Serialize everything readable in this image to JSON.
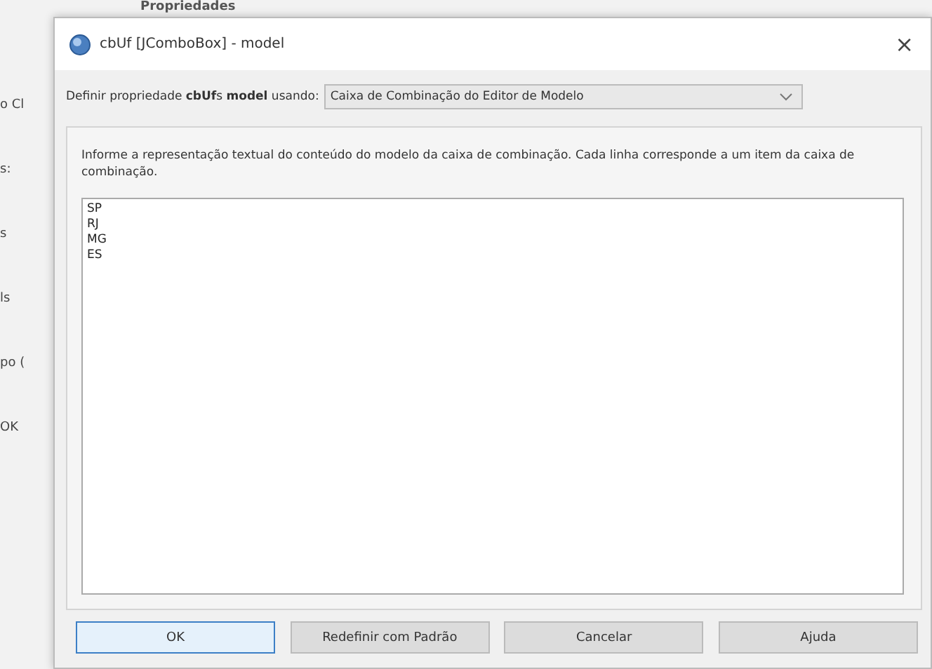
{
  "background_window": {
    "title": "Propriedades",
    "fragments": [
      "o Cl",
      "s:",
      "s",
      "ls",
      "po (",
      "OK"
    ]
  },
  "dialog": {
    "title": "cbUf [JComboBox] - model",
    "close": "×"
  },
  "property_row": {
    "label": "Definir propriedade **cbUf**s **model** usando:",
    "editor": "Caixa de Combinação do Editor de Modelo"
  },
  "description": "Informe a representação textual do conteúdo do modelo da caixa de combinação. Cada linha corresponde a um item da caixa de combinação.",
  "model_items": [
    "SP",
    "RJ",
    "MG",
    "ES"
  ],
  "buttons": [
    {
      "label": "OK",
      "default": true
    },
    {
      "label": "Redefinir com Padrão",
      "default": false
    },
    {
      "label": "Cancelar",
      "default": false
    },
    {
      "label": "Ajuda",
      "default": false
    }
  ]
}
